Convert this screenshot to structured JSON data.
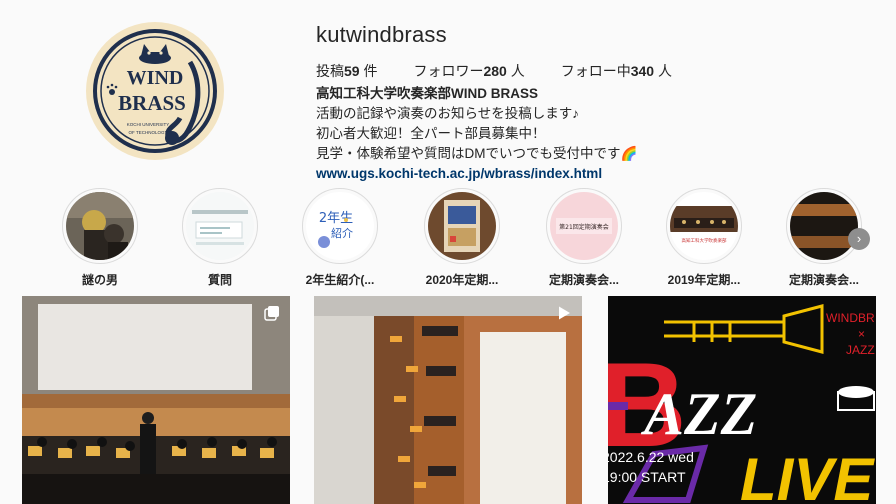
{
  "profile": {
    "username": "kutwindbrass",
    "avatar": {
      "logo_main_1": "WIND",
      "logo_main_2": "BRASS",
      "logo_sub_1": "KOCHI UNIVERSITY",
      "logo_sub_2": "OF TECHNOLOGY"
    },
    "stats": {
      "posts_label": "投稿",
      "posts_count": "59",
      "posts_unit": "件",
      "followers_label": "フォロワー",
      "followers_count": "280",
      "followers_unit": "人",
      "following_label": "フォロー中",
      "following_count": "340",
      "following_unit": "人"
    },
    "bio": {
      "name": "高知工科大学吹奏楽部WIND BRASS",
      "line1": "活動の記録や演奏のお知らせを投稿します♪",
      "line2": "初心者大歓迎！全パート部員募集中！",
      "line3": "見学・体験希望や質問はDMでいつでも受付中です🌈",
      "link": "www.ugs.kochi-tech.ac.jp/wbrass/index.html"
    }
  },
  "highlights": [
    {
      "label": "謎の男"
    },
    {
      "label": "質問"
    },
    {
      "label": "2年生紹介(..."
    },
    {
      "label": "2020年定期..."
    },
    {
      "label": "定期演奏会..."
    },
    {
      "label": "2019年定期..."
    },
    {
      "label": "定期演奏会..."
    }
  ],
  "highlight_texts": {
    "h3_text_1": "2年生",
    "h3_text_2": "紹介",
    "h5_text": "第21回定期演奏会",
    "h6_text": "高知工科大学吹奏楽部"
  },
  "highlights_next_icon": "chevron-right-icon",
  "posts": [
    {
      "type": "carousel",
      "badge_icon": "multiple-images-icon"
    },
    {
      "type": "video",
      "badge_icon": "play-icon"
    },
    {
      "type": "image",
      "poster": {
        "letter_b": "B",
        "word_azz": "AZZ",
        "word_live": "LIVE",
        "side_text_1": "WINDBR",
        "side_text_2": "×",
        "side_text_3": "JAZZ",
        "date": "2022.6.22 wed",
        "time": "19:00 START"
      }
    }
  ],
  "colors": {
    "link": "#00376b",
    "text": "#262626",
    "border": "#dbdbdb",
    "background": "#fafafa",
    "poster_red": "#e0202a",
    "poster_yellow": "#f2c200",
    "poster_purple": "#6a2aa8"
  }
}
